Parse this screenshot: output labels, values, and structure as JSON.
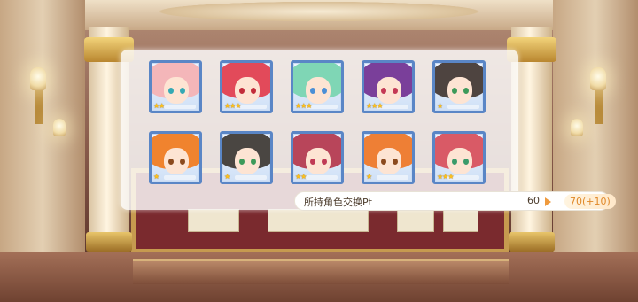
{
  "exchange": {
    "label": "所持角色交换Pt",
    "current": "60",
    "new_value": "70(+10)"
  },
  "characters": [
    {
      "rarity": 2,
      "stars": "★★",
      "hair": "#f4b6b9",
      "eye": "#35a9b4"
    },
    {
      "rarity": 3,
      "stars": "★★★",
      "hair": "#e24a5a",
      "eye": "#c22c3a"
    },
    {
      "rarity": 3,
      "stars": "★★★",
      "hair": "#7fd6b5",
      "eye": "#4b8fd6"
    },
    {
      "rarity": 3,
      "stars": "★★★",
      "hair": "#7a3f9a",
      "eye": "#c43a55"
    },
    {
      "rarity": 1,
      "stars": "★",
      "hair": "#4e4440",
      "eye": "#3d9a5a"
    },
    {
      "rarity": 1,
      "stars": "★",
      "hair": "#f0832e",
      "eye": "#8b4a1e"
    },
    {
      "rarity": 1,
      "stars": "★",
      "hair": "#4a4642",
      "eye": "#3d9a5a"
    },
    {
      "rarity": 2,
      "stars": "★★",
      "hair": "#b8455a",
      "eye": "#c03a55"
    },
    {
      "rarity": 1,
      "stars": "★",
      "hair": "#ee7f35",
      "eye": "#8b4a1e"
    },
    {
      "rarity": 3,
      "stars": "★★★",
      "hair": "#d95a66",
      "eye": "#3b9a6a"
    }
  ]
}
